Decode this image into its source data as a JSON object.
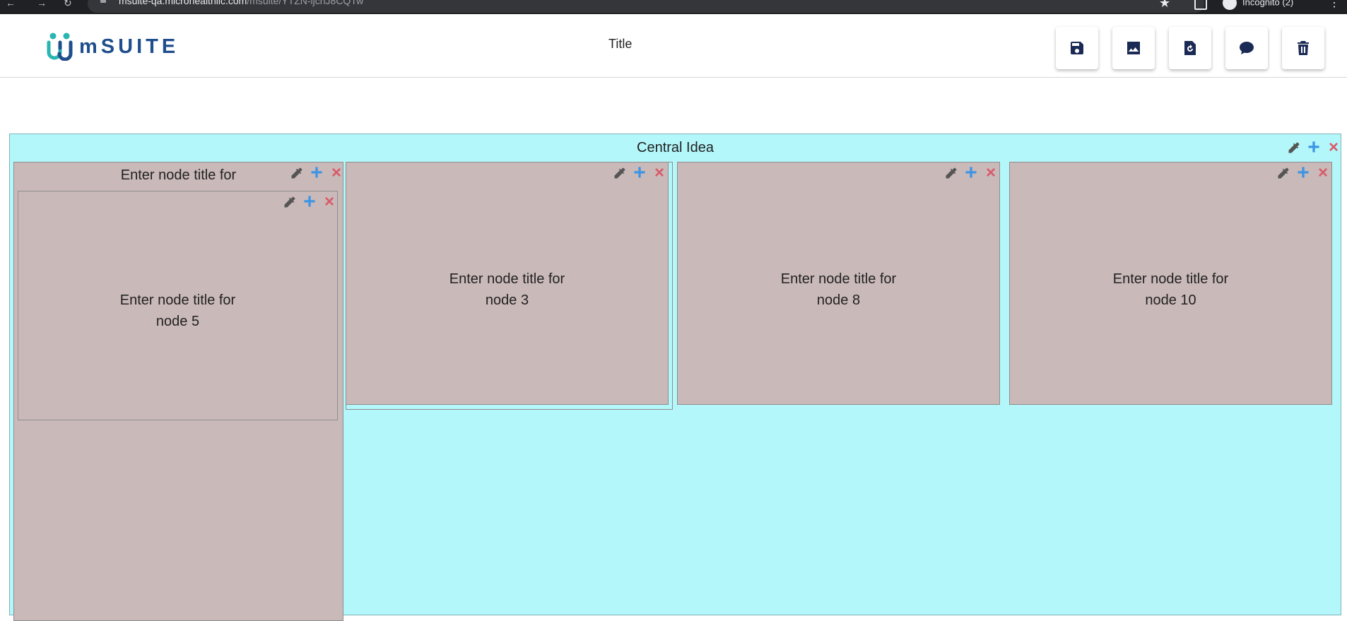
{
  "browser": {
    "url_host": "msuite-qa.microhealthllc.com",
    "url_path": "/msuite/YTZN-ljcnJ8CQTw",
    "profile_label": "Incognito (2)"
  },
  "header": {
    "logo_text": "mSUITE",
    "title": "Title"
  },
  "toolbar": {
    "buttons": [
      {
        "name": "save-button",
        "icon": "save-icon"
      },
      {
        "name": "export-image-button",
        "icon": "image-icon"
      },
      {
        "name": "reset-button",
        "icon": "file-restore-icon"
      },
      {
        "name": "comment-button",
        "icon": "comment-icon"
      },
      {
        "name": "delete-button",
        "icon": "trash-icon"
      }
    ]
  },
  "map": {
    "root_title": "Central Idea",
    "nodes": {
      "node1_title": "Enter node title for",
      "node5_title_line1": "Enter node title for",
      "node5_title_line2": "node 5",
      "node3_title_line1": "Enter node title for",
      "node3_title_line2": "node 3",
      "node8_title_line1": "Enter node title for",
      "node8_title_line2": "node 8",
      "node10_title_line1": "Enter node title for",
      "node10_title_line2": "node 10"
    },
    "icons": {
      "color_picker": "eyedropper-icon",
      "add": "plus-icon",
      "remove": "close-icon"
    }
  },
  "colors": {
    "canvas_bg": "#b3f7fb",
    "node_bg": "#cab9b9",
    "accent_blue": "#3d95e4",
    "accent_red": "#d85b6a",
    "brand": "#1f4e8c",
    "logo_teal": "#29b5b0"
  }
}
